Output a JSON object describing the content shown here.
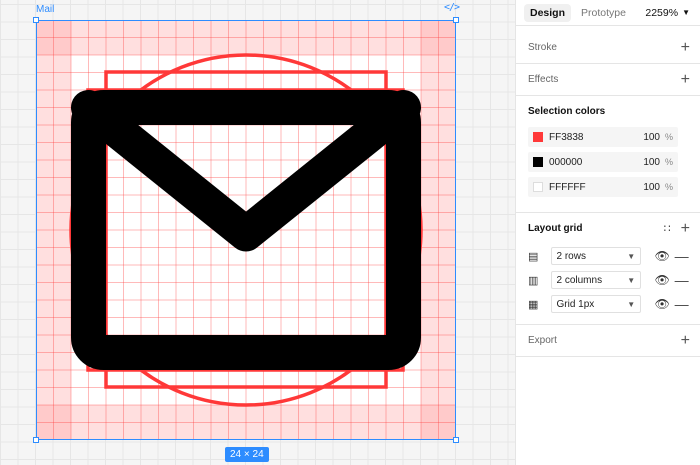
{
  "canvas": {
    "frame_name": "Mail",
    "code_icon": "code-icon",
    "size_label": "24 × 24"
  },
  "panel": {
    "tabs": [
      {
        "label": "Design",
        "active": true
      },
      {
        "label": "Prototype",
        "active": false
      }
    ],
    "zoom": "2259%",
    "sections": {
      "stroke": {
        "title": "Stroke"
      },
      "effects": {
        "title": "Effects"
      },
      "selection_colors": {
        "title": "Selection colors",
        "colors": [
          {
            "hex": "FF3838",
            "opacity": "100",
            "unit": "%",
            "swatch": "#FF3838"
          },
          {
            "hex": "000000",
            "opacity": "100",
            "unit": "%",
            "swatch": "#000000"
          },
          {
            "hex": "FFFFFF",
            "opacity": "100",
            "unit": "%",
            "swatch": "#FFFFFF"
          }
        ]
      },
      "layout_grid": {
        "title": "Layout grid",
        "grids": [
          {
            "icon": "rows-grid-icon",
            "label": "2 rows"
          },
          {
            "icon": "columns-grid-icon",
            "label": "2 columns"
          },
          {
            "icon": "pixel-grid-icon",
            "label": "Grid 1px"
          }
        ]
      },
      "export": {
        "title": "Export"
      }
    }
  },
  "colors": {
    "accent": "#2D8CFF",
    "keyline": "#FF3838",
    "icon": "#000000",
    "grid_tint": "#FFDADA"
  }
}
